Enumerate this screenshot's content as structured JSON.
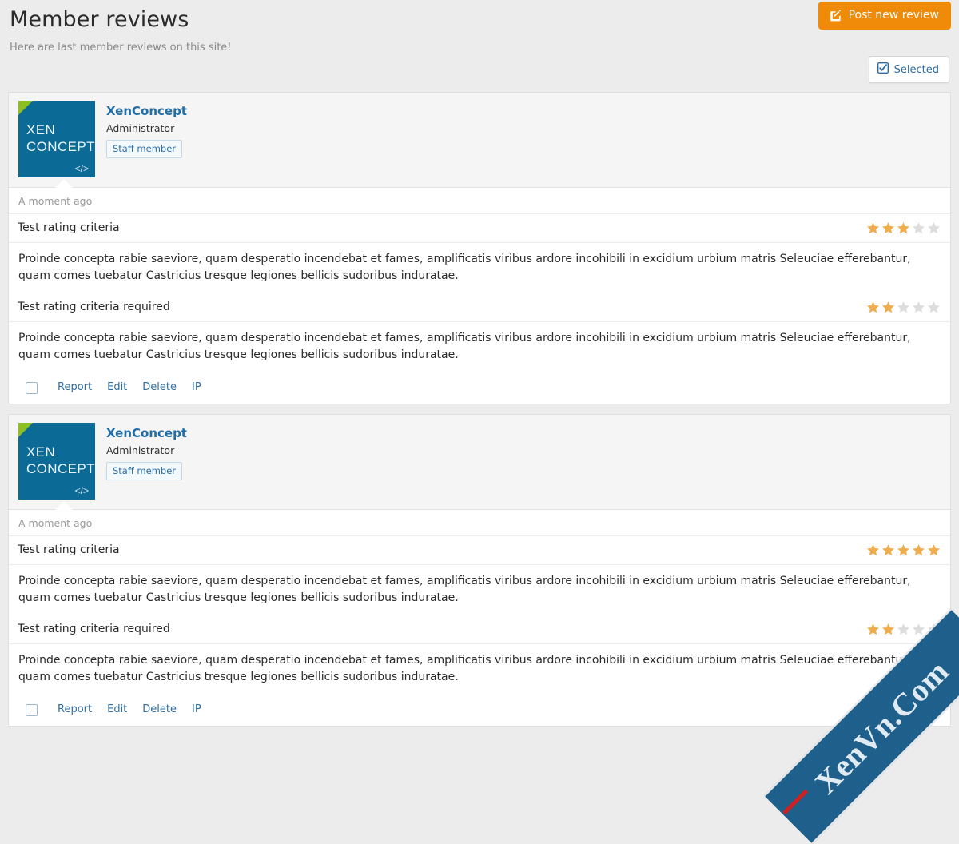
{
  "header": {
    "title": "Member reviews",
    "description": "Here are last member reviews on this site!",
    "post_button_label": "Post new review",
    "post_button_icon": "edit-pencil-icon",
    "post_button_color": "#ef8b08"
  },
  "toolbar": {
    "selected_label": "Selected",
    "selected_icon": "checked-checkbox-icon",
    "link_color": "#2d6da3"
  },
  "avatar": {
    "line1": "XEN",
    "line2": "CONCEPT",
    "code_glyph": "</>",
    "background": "#0c6a96",
    "corner_color": "#8cc01f"
  },
  "labels": {
    "star_empty_color": "#dddddd",
    "star_full_color": "#f0ad4e"
  },
  "reviews": [
    {
      "user": {
        "name": "XenConcept",
        "title": "Administrator",
        "badge": "Staff member"
      },
      "timestamp": "A moment ago",
      "criteria": [
        {
          "label": "Test rating criteria",
          "rating": 3,
          "max": 5,
          "text": "Proinde concepta rabie saeviore, quam desperatio incendebat et fames, amplificatis viribus ardore incohibili in excidium urbium matris Seleuciae efferebantur, quam comes tuebatur Castricius tresque legiones bellicis sudoribus induratae."
        },
        {
          "label": "Test rating criteria required",
          "rating": 2,
          "max": 5,
          "text": "Proinde concepta rabie saeviore, quam desperatio incendebat et fames, amplificatis viribus ardore incohibili in excidium urbium matris Seleuciae efferebantur, quam comes tuebatur Castricius tresque legiones bellicis sudoribus induratae."
        }
      ],
      "actions": [
        "Report",
        "Edit",
        "Delete",
        "IP"
      ]
    },
    {
      "user": {
        "name": "XenConcept",
        "title": "Administrator",
        "badge": "Staff member"
      },
      "timestamp": "A moment ago",
      "criteria": [
        {
          "label": "Test rating criteria",
          "rating": 5,
          "max": 5,
          "text": "Proinde concepta rabie saeviore, quam desperatio incendebat et fames, amplificatis viribus ardore incohibili in excidium urbium matris Seleuciae efferebantur, quam comes tuebatur Castricius tresque legiones bellicis sudoribus induratae."
        },
        {
          "label": "Test rating criteria required",
          "rating": 2,
          "max": 5,
          "text": "Proinde concepta rabie saeviore, quam desperatio incendebat et fames, amplificatis viribus ardore incohibili in excidium urbium matris Seleuciae efferebantur, quam comes tuebatur Castricius tresque legiones bellicis sudoribus induratae."
        }
      ],
      "actions": [
        "Report",
        "Edit",
        "Delete",
        "IP"
      ]
    }
  ],
  "watermark": {
    "text": "XenVn.Com",
    "background": "#1f5f8b"
  }
}
